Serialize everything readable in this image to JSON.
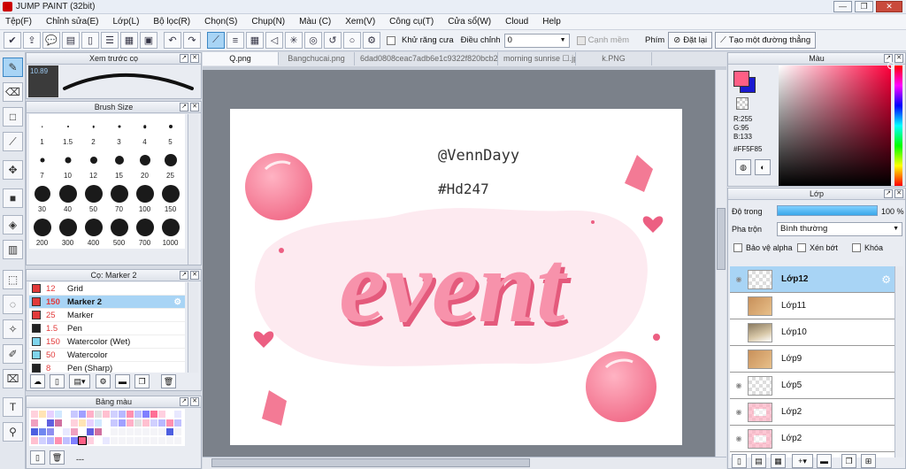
{
  "app": {
    "title": "JUMP PAINT (32bit)"
  },
  "window_controls": {
    "minimize": "—",
    "restore": "❐",
    "close": "✕"
  },
  "menu": [
    "Tệp(F)",
    "Chỉnh sửa(E)",
    "Lớp(L)",
    "Bộ lọc(R)",
    "Chọn(S)",
    "Chụp(N)",
    "Màu (C)",
    "Xem(V)",
    "Công cụ(T)",
    "Cửa sổ(W)",
    "Cloud",
    "Help"
  ],
  "toolbar": {
    "antialias_label": "Khử răng cưa",
    "adjust_label": "Điều chỉnh",
    "adjust_value": "0",
    "snap_label": "Cạnh mềm",
    "key_label": "Phím",
    "reset_label": "Đặt lại",
    "straight_line_label": "Tạo một đường thẳng"
  },
  "preview_panel": {
    "title": "Xem trước cọ",
    "size": "10.89"
  },
  "brush_size_panel": {
    "title": "Brush Size",
    "sizes": [
      "1",
      "1.5",
      "2",
      "3",
      "4",
      "5",
      "7",
      "10",
      "12",
      "15",
      "20",
      "25",
      "30",
      "40",
      "50",
      "70",
      "100",
      "150",
      "200",
      "300",
      "400",
      "500",
      "700",
      "1000"
    ]
  },
  "brush_panel": {
    "title": "Cọ: Marker 2",
    "items": [
      {
        "size": "12",
        "name": "Grid",
        "color": "#e23a3a"
      },
      {
        "size": "150",
        "name": "Marker 2",
        "color": "#e23a3a"
      },
      {
        "size": "25",
        "name": "Marker",
        "color": "#e23a3a"
      },
      {
        "size": "1.5",
        "name": "Pen",
        "color": "#222222"
      },
      {
        "size": "150",
        "name": "Watercolor (Wet)",
        "color": "#7fd4ec"
      },
      {
        "size": "50",
        "name": "Watercolor",
        "color": "#7fd4ec"
      },
      {
        "size": "8",
        "name": "Pen (Sharp)",
        "color": "#222222"
      }
    ]
  },
  "palette_panel": {
    "title": "Bảng màu",
    "status": "---"
  },
  "document": {
    "tabs": [
      "Q.png",
      "Bangchucai.png",
      "6dad0808ceac7adb6e1c9322f820bcb2.jpg",
      "morning sunrise ☐.jpg",
      "k.PNG"
    ],
    "watermark_name": "@VennDayy",
    "watermark_tag": "#Hd247",
    "artwork_word": "event"
  },
  "color_panel": {
    "title": "Màu",
    "r": "R:255",
    "g": "G:95",
    "b": "B:133",
    "hex": "#FF5F85",
    "accent": "#ff5f85"
  },
  "layer_panel": {
    "title": "Lớp",
    "opacity_label": "Độ trong",
    "opacity_value": "100 %",
    "blend_label": "Pha trộn",
    "blend_value": "Bình thường",
    "protect_alpha": "Bảo vệ alpha",
    "clip": "Xén bớt",
    "lock": "Khóa",
    "layers": [
      "Lớp12",
      "Lớp11",
      "Lớp10",
      "Lớp9",
      "Lớp5",
      "Lớp2",
      "Lớp2"
    ]
  }
}
